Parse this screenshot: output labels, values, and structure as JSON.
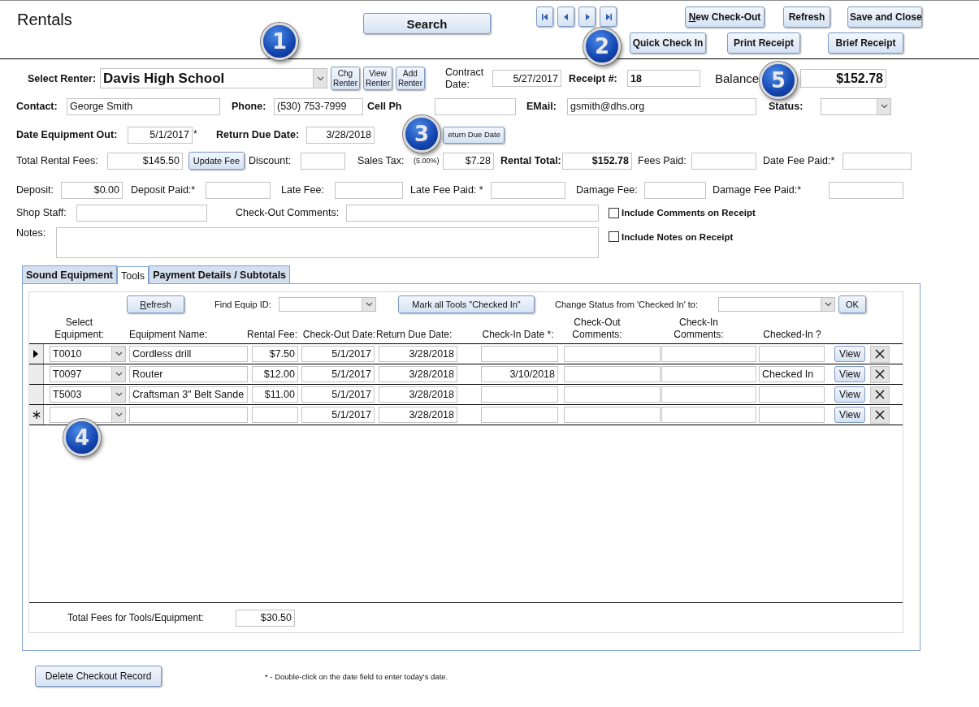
{
  "title": "Rentals",
  "search_button": "Search",
  "record_nav": [
    {
      "kind": "first"
    },
    {
      "kind": "previous"
    },
    {
      "kind": "next"
    },
    {
      "kind": "last"
    }
  ],
  "action_buttons": [
    [
      {
        "label": "New Check-Out",
        "mnemonic": true
      },
      {
        "label": "Refresh",
        "mnemonic": false
      },
      {
        "label": "Save and Close",
        "mnemonic": false
      }
    ],
    [
      {
        "label": "Quick Check In",
        "mnemonic": false
      },
      {
        "label": "Print Receipt",
        "mnemonic": false
      },
      {
        "label": "Brief Receipt",
        "mnemonic": false
      }
    ]
  ],
  "form_rows": [
    {
      "items": [
        {
          "kind": "label",
          "text": "Select Renter:"
        },
        {
          "kind": "combo",
          "value": "Davis High School"
        },
        {
          "kind": "button",
          "label": "Chg Renter"
        },
        {
          "kind": "button",
          "label": "View Renter"
        },
        {
          "kind": "button",
          "label": "Add Renter"
        },
        {
          "kind": "label",
          "text": "Contract Date:"
        },
        {
          "kind": "field",
          "value": "5/27/2017"
        },
        {
          "kind": "label",
          "text": "Receipt #:"
        },
        {
          "kind": "field",
          "value": "18"
        },
        {
          "kind": "label",
          "text": "Balance"
        },
        {
          "kind": "field",
          "value": "$152.78"
        }
      ]
    },
    {
      "items": [
        {
          "kind": "label",
          "text": "Contact:"
        },
        {
          "kind": "field",
          "value": "George Smith"
        },
        {
          "kind": "label",
          "text": "Phone:"
        },
        {
          "kind": "field",
          "value": "(530) 753-7999"
        },
        {
          "kind": "label",
          "text": "Cell Ph"
        },
        {
          "kind": "field"
        },
        {
          "kind": "label",
          "text": "EMail:"
        },
        {
          "kind": "field",
          "value": "gsmith@dhs.org"
        },
        {
          "kind": "label",
          "text": "Status:"
        },
        {
          "kind": "combo"
        }
      ]
    },
    {
      "items": [
        {
          "kind": "label",
          "text": "Date Equipment Out:"
        },
        {
          "kind": "field",
          "value": "5/1/2017"
        },
        {
          "kind": "note",
          "text": "*"
        },
        {
          "kind": "label",
          "text": "Return Due Date:"
        },
        {
          "kind": "field",
          "value": "3/28/2018"
        },
        {
          "kind": "button",
          "label": "eturn Due Date"
        }
      ]
    },
    {
      "items": [
        {
          "kind": "label",
          "text": "Total Rental Fees:"
        },
        {
          "kind": "field",
          "value": "$145.50"
        },
        {
          "kind": "button",
          "label": "Update Fee"
        },
        {
          "kind": "label",
          "text": "Discount:"
        },
        {
          "kind": "field"
        },
        {
          "kind": "label",
          "text": "Sales Tax:"
        },
        {
          "kind": "note",
          "text": "(5.00%)"
        },
        {
          "kind": "field",
          "value": "$7.28"
        },
        {
          "kind": "label",
          "text": "Rental Total:"
        },
        {
          "kind": "field",
          "value": "$152.78"
        },
        {
          "kind": "label",
          "text": "Fees Paid:"
        },
        {
          "kind": "field"
        },
        {
          "kind": "label",
          "text": "Date Fee Paid:*"
        },
        {
          "kind": "field"
        }
      ]
    },
    {
      "items": [
        {
          "kind": "label",
          "text": "Deposit:"
        },
        {
          "kind": "field",
          "value": "$0.00"
        },
        {
          "kind": "label",
          "text": "Deposit Paid:*"
        },
        {
          "kind": "field"
        },
        {
          "kind": "label",
          "text": "Late Fee:"
        },
        {
          "kind": "field"
        },
        {
          "kind": "label",
          "text": "Late Fee Paid: *"
        },
        {
          "kind": "field"
        },
        {
          "kind": "label",
          "text": "Damage Fee:"
        },
        {
          "kind": "field"
        },
        {
          "kind": "label",
          "text": "Damage Fee Paid:*"
        },
        {
          "kind": "field"
        }
      ]
    },
    {
      "items": [
        {
          "kind": "label",
          "text": "Shop Staff:"
        },
        {
          "kind": "field"
        },
        {
          "kind": "label",
          "text": "Check-Out Comments:"
        },
        {
          "kind": "field"
        },
        {
          "kind": "checkbox",
          "label": "Include Comments on Receipt",
          "checked": false
        }
      ]
    },
    {
      "items": [
        {
          "kind": "label",
          "text": "Notes:"
        },
        {
          "kind": "textarea"
        },
        {
          "kind": "checkbox",
          "label": "Include Notes on Receipt",
          "checked": false
        }
      ]
    }
  ],
  "tabs": [
    {
      "label": "Sound Equipment",
      "selected": false
    },
    {
      "label": "Tools",
      "selected": true
    },
    {
      "label": "Payment Details /  Subtotals",
      "selected": false
    }
  ],
  "tools": {
    "refresh_button": {
      "label": "Refresh",
      "mnemonic": true
    },
    "find_label": "Find Equip ID:",
    "mark_button": "Mark all Tools \"Checked In\"",
    "status_label": "Change Status from 'Checked In'  to:",
    "ok_button": "OK",
    "columns": [
      "Select Equipment:",
      "Equipment Name:",
      "Rental Fee:",
      "Check-Out Date:",
      "Return Due Date:",
      "Check-In Date *:",
      "Check-Out Comments:",
      "Check-In Comments:",
      "Checked-In ?"
    ],
    "rows": [
      {
        "current": true,
        "new_record": false,
        "equipment": "T0010",
        "name": "Cordless drill",
        "fee": "$7.50",
        "out_date": "5/1/2017",
        "due_date": "3/28/2018",
        "view": "View"
      },
      {
        "current": false,
        "new_record": false,
        "equipment": "T0097",
        "name": "Router",
        "fee": "$12.00",
        "out_date": "5/1/2017",
        "due_date": "3/28/2018",
        "checkin_date": "3/10/2018",
        "checked_in": "Checked In",
        "view": "View"
      },
      {
        "current": false,
        "new_record": false,
        "equipment": "T5003",
        "name": "Craftsman 3\" Belt Sande",
        "fee": "$11.00",
        "out_date": "5/1/2017",
        "due_date": "3/28/2018",
        "view": "View"
      },
      {
        "current": false,
        "new_record": true,
        "out_date": "5/1/2017",
        "due_date": "3/28/2018",
        "view": "View"
      }
    ],
    "total_label": "Total Fees for Tools/Equipment:",
    "total_value": "$30.50"
  },
  "delete_button": "Delete Checkout Record",
  "footnote": "* - Double-click on the date field to enter  today's date.",
  "callouts": [
    "1",
    "2",
    "3",
    "4",
    "5"
  ]
}
